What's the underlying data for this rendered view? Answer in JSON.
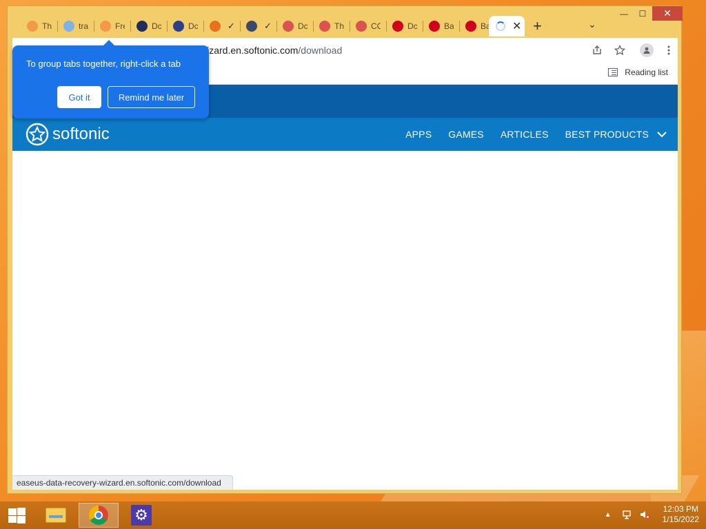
{
  "browser": {
    "tabs": [
      {
        "label": "Th",
        "color": "#f2994a"
      },
      {
        "label": "tra",
        "color": "#7fb2e5"
      },
      {
        "label": "Fre",
        "color": "#f2994a"
      },
      {
        "label": "Dc",
        "color": "#1f2d5a"
      },
      {
        "label": "Dc",
        "color": "#2b3f8a"
      },
      {
        "label": "",
        "color": "#e8711c"
      },
      {
        "label": "",
        "color": "#3a4a6b"
      },
      {
        "label": "Dc",
        "color": "#d9534f"
      },
      {
        "label": "Th",
        "color": "#d9534f"
      },
      {
        "label": "CC",
        "color": "#d9534f"
      },
      {
        "label": "Dc",
        "color": "#d0021b"
      },
      {
        "label": "Ba",
        "color": "#d0021b"
      },
      {
        "label": "Ba",
        "color": "#d0021b"
      }
    ],
    "new_tab": "+",
    "tab_search": "⌄",
    "close_tab": "✕",
    "window": {
      "minimize": "—",
      "maximize": "☐",
      "close": "✕"
    },
    "url_main": "wizard.en.softonic.com",
    "url_path": "/download",
    "reading_list": "Reading list",
    "status_url": "easeus-data-recovery-wizard.en.softonic.com/download"
  },
  "callout": {
    "text": "To group tabs together, right-click a tab",
    "got_it": "Got it",
    "remind": "Remind me later"
  },
  "site": {
    "logo": "softonic",
    "nav": [
      "APPS",
      "GAMES",
      "ARTICLES",
      "BEST PRODUCTS"
    ],
    "topbar_color": "#0a5ea6",
    "navbar_color": "#0c7ac4"
  },
  "taskbar": {
    "time": "12:03 PM",
    "date": "1/15/2022"
  }
}
